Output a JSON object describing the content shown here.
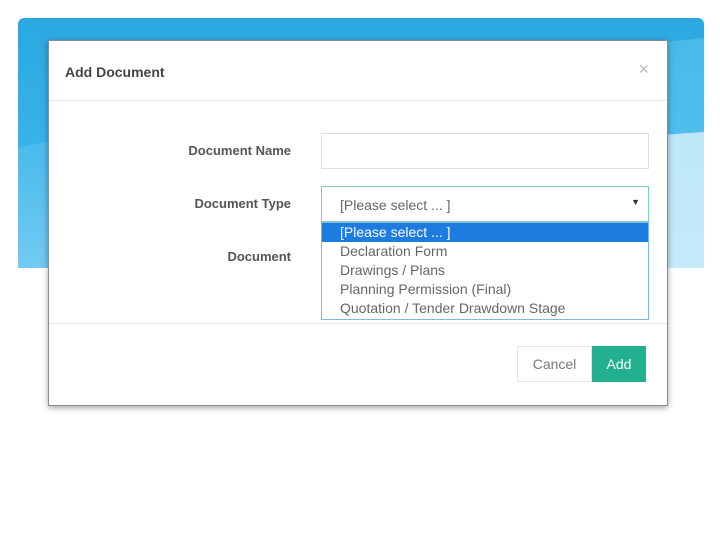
{
  "modal": {
    "title": "Add Document",
    "close_icon": "×"
  },
  "form": {
    "document_name_label": "Document Name",
    "document_name_value": "",
    "document_type_label": "Document Type",
    "document_type_selected": "[Please select ... ]",
    "document_label": "Document"
  },
  "dropdown": {
    "options": [
      "[Please select ... ]",
      "Declaration Form",
      "Drawings / Plans",
      "Planning Permission (Final)",
      "Quotation / Tender Drawdown Stage"
    ],
    "highlighted_index": 0
  },
  "footer": {
    "cancel_label": "Cancel",
    "add_label": "Add"
  },
  "colors": {
    "accent_add_button": "#22b08e",
    "dropdown_highlight": "#1e7be0",
    "slide_background": "#2aa8e0"
  },
  "icons": {
    "close": "close-icon",
    "select_arrow": "caret-down-icon"
  }
}
